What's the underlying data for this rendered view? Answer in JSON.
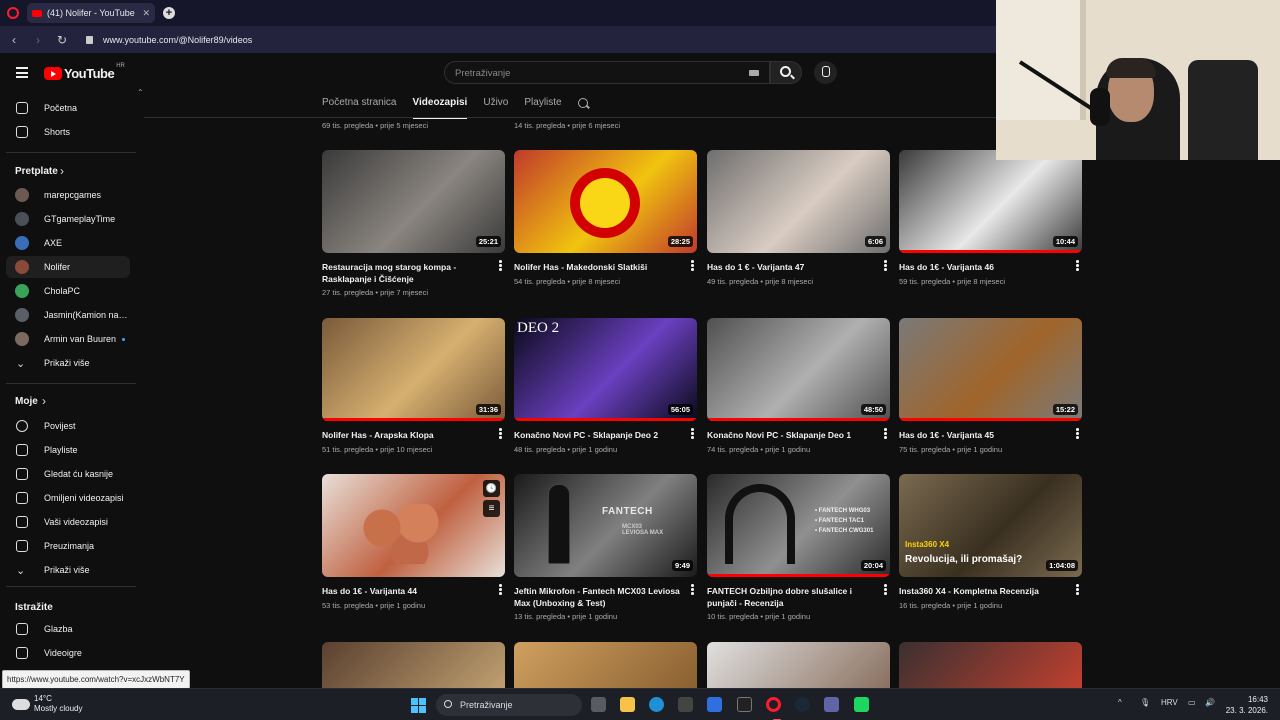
{
  "browser": {
    "tab_title": "(41) Nolifer - YouTube",
    "url": "www.youtube.com/@Nolifer89/videos",
    "status_url": "https://www.youtube.com/watch?v=xcJxzWbNT7Y"
  },
  "header": {
    "logo": "YouTube",
    "region": "HR",
    "search_placeholder": "Pretraživanje"
  },
  "sidebar": {
    "top": [
      {
        "label": "Početna",
        "icon": "home-icon"
      },
      {
        "label": "Shorts",
        "icon": "shorts-icon"
      }
    ],
    "subs_heading": "Pretplate",
    "subscriptions": [
      {
        "label": "marepcgames",
        "color": "#6b5a52"
      },
      {
        "label": "GTgameplayTime",
        "color": "#4a4f58"
      },
      {
        "label": "AXE",
        "color": "#3a6db8"
      },
      {
        "label": "Nolifer",
        "color": "#8a4a3a"
      },
      {
        "label": "CholaPC",
        "color": "#3aa35a"
      },
      {
        "label": "Jasmin(Kamion na ...",
        "color": "#5a5e66"
      },
      {
        "label": "Armin van Buuren",
        "color": "#7a6a60"
      }
    ],
    "subs_more": "Prikaži više",
    "you_heading": "Moje",
    "you_items": [
      {
        "label": "Povijest",
        "icon": "history-icon"
      },
      {
        "label": "Playliste",
        "icon": "playlist-icon"
      },
      {
        "label": "Gledat ću kasnije",
        "icon": "watch-later-icon"
      },
      {
        "label": "Omiljeni videozapisi",
        "icon": "like-icon"
      },
      {
        "label": "Vaši videozapisi",
        "icon": "your-videos-icon"
      },
      {
        "label": "Preuzimanja",
        "icon": "download-icon"
      },
      {
        "label": "Prikaži više",
        "icon": "chevron-down-icon"
      }
    ],
    "explore_heading": "Istražite",
    "explore_items": [
      {
        "label": "Glazba",
        "icon": "music-icon"
      },
      {
        "label": "Videoigre",
        "icon": "gaming-icon"
      }
    ]
  },
  "channel_tabs": [
    "Početna stranica",
    "Videozapisi",
    "Uživo",
    "Playliste"
  ],
  "top_meta": [
    "69 tis. pregleda • prije 5 mjeseci",
    "14 tis. pregleda • prije 6 mjeseci"
  ],
  "videos": [
    {
      "title": "Restauracija mog starog kompa - Rasklapanje i Čišćenje",
      "meta": "27 tis. pregleda • prije 7 mjeseci",
      "duration": "25:21",
      "progress": 0,
      "colors": [
        "#3a3a3a",
        "#8a8580"
      ]
    },
    {
      "title": "Nolifer Has - Makedonski Slatkiši",
      "meta": "54 tis. pregleda • prije 8 mjeseci",
      "duration": "28:25",
      "progress": 0,
      "colors": [
        "#c0392b",
        "#f1c40f"
      ]
    },
    {
      "title": "Has do 1 € - Varijanta 47",
      "meta": "49 tis. pregleda • prije 8 mjeseci",
      "duration": "6:06",
      "progress": 0,
      "colors": [
        "#6e6e6e",
        "#d9ccc2"
      ]
    },
    {
      "title": "Has do 1€ - Varijanta 46",
      "meta": "59 tis. pregleda • prije 8 mjeseci",
      "duration": "10:44",
      "progress": 1.0,
      "colors": [
        "#3a3a3a",
        "#e8e8e8"
      ]
    },
    {
      "title": "Nolifer Has - Arapska Klopa",
      "meta": "51 tis. pregleda • prije 10 mjeseci",
      "duration": "31:36",
      "progress": 1.0,
      "colors": [
        "#7a5a3a",
        "#d6b070"
      ]
    },
    {
      "title": "Konačno Novi PC - Sklapanje Deo 2",
      "meta": "48 tis. pregleda • prije 1 godinu",
      "duration": "56:05",
      "progress": 1.0,
      "colors": [
        "#0a0a1a",
        "#6a40c0"
      ]
    },
    {
      "title": "Konačno Novi PC - Sklapanje Deo 1",
      "meta": "74 tis. pregleda • prije 1 godinu",
      "duration": "48:50",
      "progress": 1.0,
      "colors": [
        "#505050",
        "#b0b0b0"
      ]
    },
    {
      "title": "Has do 1€ - Varijanta 45",
      "meta": "75 tis. pregleda • prije 1 godinu",
      "duration": "15:22",
      "progress": 1.0,
      "colors": [
        "#7a7a7a",
        "#a0652a"
      ]
    },
    {
      "title": "Has do 1€ - Varijanta 44",
      "meta": "53 tis. pregleda • prije 1 godinu",
      "duration": "",
      "progress": 0,
      "colors": [
        "#e8e0d8",
        "#c06040"
      ]
    },
    {
      "title": "Jeftin Mikrofon - Fantech MCX03 Leviosa Max (Unboxing & Test)",
      "meta": "13 tis. pregleda • prije 1 godinu",
      "duration": "9:49",
      "progress": 0,
      "colors": [
        "#1a1a1a",
        "#808080"
      ]
    },
    {
      "title": "FANTECH Ozbiljno dobre slušalice i punjači - Recenzija",
      "meta": "10 tis. pregleda • prije 1 godinu",
      "duration": "20:04",
      "progress": 1.0,
      "colors": [
        "#2a2a2a",
        "#909090"
      ]
    },
    {
      "title": "Insta360 X4 - Kompletna Recenzija",
      "meta": "16 tis. pregleda • prije 1 godinu",
      "duration": "1:04:08",
      "progress": 0,
      "colors": [
        "#7a6a50",
        "#3a3020"
      ]
    }
  ],
  "thumb_texts": {
    "deo2": "DEO 2",
    "fantech": "FANTECH",
    "mcx03": "MCX03\nLEVIOSA MAX",
    "headset": "• FANTECH WHG03\n• FANTECH TAC1\n• FANTECH CWG301",
    "insta_brand": "Insta360 X4",
    "insta_question": "Revolucija, ili promašaj?"
  },
  "taskbar": {
    "temperature": "14°C",
    "weather": "Mostly cloudy",
    "search": "Pretraživanje",
    "language": "HRV",
    "time": "16:43",
    "date": "23. 3. 2026."
  }
}
